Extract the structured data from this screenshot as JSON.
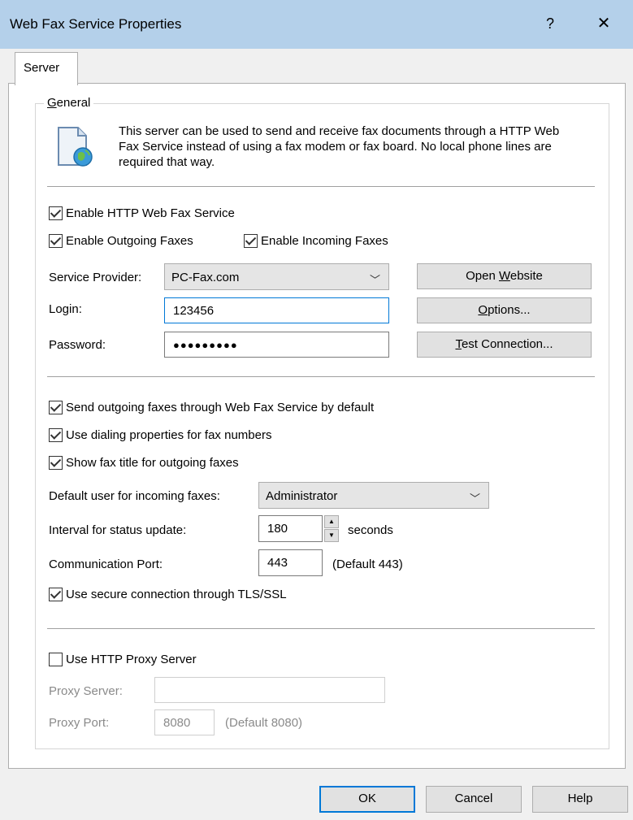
{
  "window": {
    "title": "Web Fax Service Properties",
    "help_glyph": "?",
    "close_glyph": "✕"
  },
  "tabs": [
    {
      "label": "Server"
    }
  ],
  "general": {
    "group_label_underlined": "G",
    "group_label_rest": "eneral",
    "description": "This server can be used to send and receive fax documents through a HTTP Web Fax Service instead of using a fax modem or fax board. No local phone lines are required that way.",
    "icon": "fax-document-globe-icon"
  },
  "checkboxes": {
    "enable_http": {
      "label": "Enable HTTP Web Fax Service",
      "checked": true
    },
    "enable_outgoing": {
      "label": "Enable Outgoing Faxes",
      "checked": true
    },
    "enable_incoming": {
      "label": "Enable Incoming Faxes",
      "checked": true
    },
    "send_default": {
      "label": "Send outgoing faxes through Web Fax Service by default",
      "checked": true
    },
    "use_dialing": {
      "label": "Use dialing properties for fax numbers",
      "checked": true
    },
    "show_title": {
      "label": "Show fax title for outgoing faxes",
      "checked": true
    },
    "secure_tls": {
      "label": "Use secure connection through TLS/SSL",
      "checked": true
    },
    "use_proxy": {
      "label": "Use HTTP Proxy Server",
      "checked": false
    }
  },
  "fields": {
    "service_provider": {
      "label": "Service Provider:",
      "value": "PC-Fax.com"
    },
    "login": {
      "label": "Login:",
      "value": "123456"
    },
    "password": {
      "label": "Password:",
      "value": "●●●●●●●●●"
    },
    "default_user": {
      "label": "Default user for incoming faxes:",
      "value": "Administrator"
    },
    "interval": {
      "label": "Interval for status update:",
      "value": "180",
      "unit": "seconds"
    },
    "port": {
      "label": "Communication Port:",
      "value": "443",
      "hint": "(Default 443)"
    },
    "proxy_server": {
      "label": "Proxy Server:",
      "value": ""
    },
    "proxy_port": {
      "label": "Proxy Port:",
      "value": "8080",
      "hint": "(Default 8080)"
    }
  },
  "buttons": {
    "open_website": {
      "pre": "Open ",
      "u": "W",
      "post": "ebsite"
    },
    "options": {
      "pre": "",
      "u": "O",
      "post": "ptions..."
    },
    "test_connection": {
      "pre": "",
      "u": "T",
      "post": "est Connection..."
    },
    "ok": "OK",
    "cancel": "Cancel",
    "help": "Help"
  },
  "colors": {
    "titlebar": "#b4d0ea",
    "focus_border": "#0078d7"
  }
}
